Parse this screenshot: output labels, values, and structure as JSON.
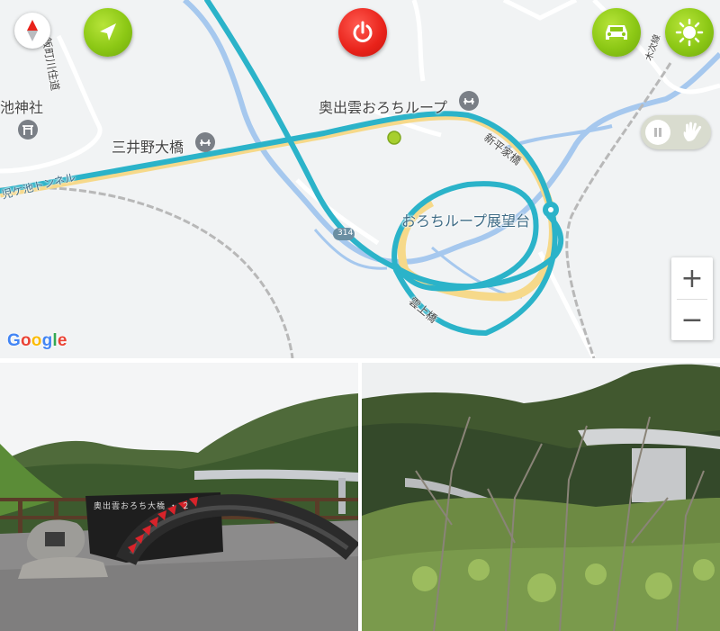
{
  "map": {
    "labels": {
      "kanji_road": "飯町川住道",
      "shrine": "池神社",
      "mitsui_bridge": "三井野大橋",
      "loop_name": "奥出雲おろちループ",
      "shinhira_bridge": "新平家橋",
      "observatory": "おろちループ展望台",
      "tunnel": "児ケ池トンネル",
      "route_number": "314",
      "unjo_bridge": "雲上橋",
      "kisuki_line": "木次線"
    },
    "zoom": {
      "in_label": "+",
      "out_label": "−"
    },
    "attribution": [
      "G",
      "o",
      "o",
      "g",
      "l",
      "e"
    ],
    "colors": {
      "route": "#2bb3c9",
      "road_highlight": "#f6d98a",
      "water": "#a6c8ee",
      "background": "#f1f3f4",
      "green_button": "#8cc815",
      "power_button": "#e8221a"
    },
    "icons": {
      "compass": "compass-icon",
      "navigate": "navigation-arrow-icon",
      "power": "power-icon",
      "car": "car-icon",
      "brightness": "sun-icon",
      "pause": "pause-icon",
      "hand": "hand-icon"
    }
  },
  "photos": {
    "left_sign_text": "奥出雲おろち大橋 ・ ２"
  }
}
